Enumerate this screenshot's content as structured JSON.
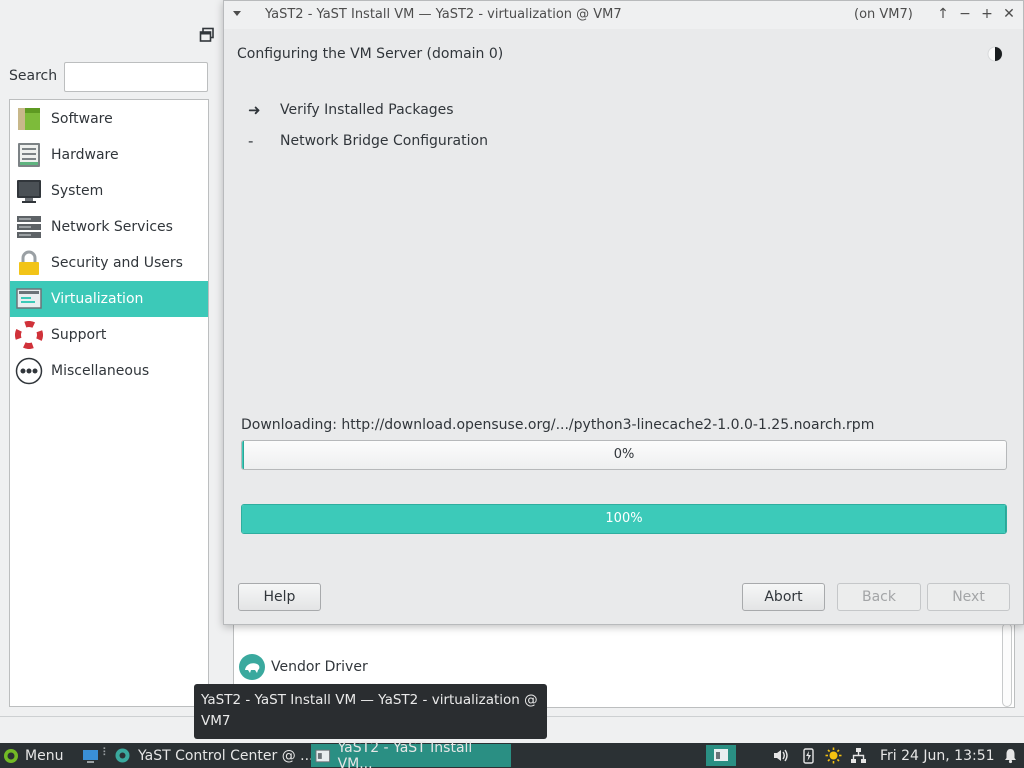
{
  "control_center": {
    "search_label": "Search",
    "search_value": "",
    "categories": [
      {
        "label": "Software",
        "icon": "software-package-icon"
      },
      {
        "label": "Hardware",
        "icon": "hardware-icon"
      },
      {
        "label": "System",
        "icon": "system-monitor-icon"
      },
      {
        "label": "Network Services",
        "icon": "network-server-icon"
      },
      {
        "label": "Security and Users",
        "icon": "lock-icon"
      },
      {
        "label": "Virtualization",
        "icon": "virtualization-icon"
      },
      {
        "label": "Support",
        "icon": "lifebuoy-icon"
      },
      {
        "label": "Miscellaneous",
        "icon": "more-dots-icon"
      }
    ],
    "selected_category": "Virtualization",
    "module_item": "Vendor Driver"
  },
  "dialog": {
    "title": "YaST2 - YaST Install VM — YaST2 - virtualization @ VM7",
    "host": "(on VM7)",
    "heading": "Configuring the VM Server (domain 0)",
    "steps": [
      {
        "mark": "➜",
        "label": "Verify Installed Packages"
      },
      {
        "mark": "-",
        "label": "Network Bridge Configuration"
      }
    ],
    "download_label": "Downloading: http://download.opensuse.org/.../python3-linecache2-1.0.0-1.25.noarch.rpm",
    "progress_current": {
      "text": "0%",
      "value": 0.0
    },
    "progress_total": {
      "text": "100%",
      "value": 1.0
    },
    "buttons": {
      "help": "Help",
      "abort": "Abort",
      "back": "Back",
      "next": "Next"
    }
  },
  "tooltip": {
    "text": "YaST2 - YaST Install VM — YaST2 - virtualization @ VM7"
  },
  "taskbar": {
    "menu_label": "Menu",
    "tasks": [
      {
        "label": "YaST Control Center @ ...",
        "active": false
      },
      {
        "label": "YaST2 - YaST Install VM...",
        "active": true
      }
    ],
    "clock": "Fri 24 Jun, 13:51"
  },
  "colors": {
    "accent": "#3cc9b8",
    "taskbar": "#2b3134",
    "tooltip_bg": "#2a2d30"
  }
}
